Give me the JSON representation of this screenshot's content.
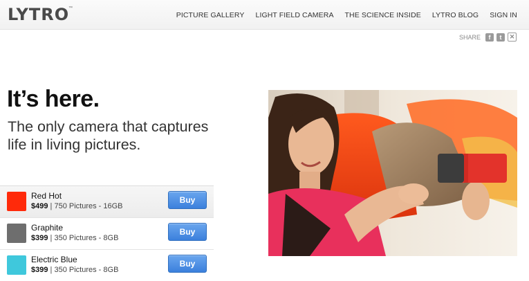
{
  "header": {
    "logo": "LYTRO",
    "trademark": "™",
    "nav": [
      "PICTURE GALLERY",
      "LIGHT FIELD CAMERA",
      "THE SCIENCE INSIDE",
      "LYTRO BLOG",
      "SIGN IN"
    ]
  },
  "share": {
    "label": "SHARE",
    "buttons": [
      {
        "icon": "facebook-icon",
        "glyph": "f"
      },
      {
        "icon": "twitter-icon",
        "glyph": "t"
      },
      {
        "icon": "mail-icon",
        "glyph": "✕"
      }
    ]
  },
  "hero": {
    "headline": "It’s here.",
    "subhead": "The only camera that captures life in living pictures."
  },
  "products": [
    {
      "name": "Red Hot",
      "price": "$499",
      "separator": "|",
      "spec": "750 Pictures - 16GB",
      "color": "#ff2a0a",
      "buy_label": "Buy"
    },
    {
      "name": "Graphite",
      "price": "$399",
      "separator": "|",
      "spec": "350 Pictures - 8GB",
      "color": "#6e6e6e",
      "buy_label": "Buy"
    },
    {
      "name": "Electric Blue",
      "price": "$399",
      "separator": "|",
      "spec": "350 Pictures - 8GB",
      "color": "#3fc8dc",
      "buy_label": "Buy"
    }
  ],
  "colors": {
    "accent_button": "#3b80dc"
  }
}
